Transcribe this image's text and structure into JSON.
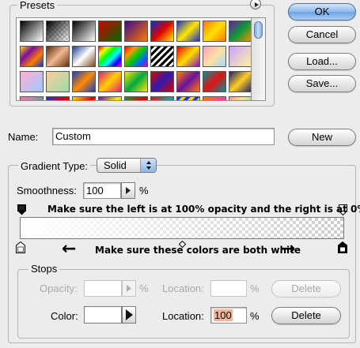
{
  "presets": {
    "label": "Presets",
    "menu_icon": "triangle-right-icon",
    "swatches": [
      {
        "name": "foreground-to-background",
        "css": "linear-gradient(135deg,#000 0%,#fff 100%)"
      },
      {
        "name": "foreground-to-transparent",
        "css": "linear-gradient(135deg,#000 0%,rgba(0,0,0,0) 100%)"
      },
      {
        "name": "black-white",
        "css": "linear-gradient(135deg,#000,#fff)"
      },
      {
        "name": "red-green",
        "css": "linear-gradient(135deg,#d40000,#006b00)"
      },
      {
        "name": "violet-orange",
        "css": "linear-gradient(135deg,#3a0a8c,#ff7a00)"
      },
      {
        "name": "blue-red-yellow",
        "css": "linear-gradient(135deg,#0033cc,#e00000 50%,#ffee00)"
      },
      {
        "name": "blue-yellow-blue",
        "css": "linear-gradient(135deg,#1a2fd0,#ffe600 50%,#1a2fd0)"
      },
      {
        "name": "orange-yellow-orange",
        "css": "linear-gradient(135deg,#ff7a00,#ffe000 50%,#ff7a00)"
      },
      {
        "name": "violet-green-orange",
        "css": "linear-gradient(135deg,#6b1aa0,#0c9a3a 50%,#ff8c00)"
      },
      {
        "name": "yellow-violet-orange-blue",
        "css": "linear-gradient(135deg,#ffd400,#7a0fa0 33%,#ff7a00 66%,#0a3cd0)"
      },
      {
        "name": "copper",
        "css": "linear-gradient(135deg,#5a2a10,#f0b890 50%,#6a3010)"
      },
      {
        "name": "chrome",
        "css": "linear-gradient(135deg,#1d3c8a,#ffffff 50%,#7a4a20)"
      },
      {
        "name": "spectrum",
        "css": "linear-gradient(135deg,#ff0000,#ffff00 20%,#00ff00 40%,#00ffff 60%,#0000ff 80%,#ff00ff)"
      },
      {
        "name": "transparent-rainbow",
        "css": "linear-gradient(135deg,#ff0000,#ff9900 25%,#00cc00 50%,#0066ff 75%,#cc00cc)"
      },
      {
        "name": "transparent-stripes",
        "css": "repeating-linear-gradient(135deg,#000 0 3px,#fff 3px 6px)"
      },
      {
        "name": "red-yellow-violet",
        "css": "linear-gradient(135deg,#e00000,#ffe000 50%,#8a10c0)"
      },
      {
        "name": "pastel",
        "css": "linear-gradient(135deg,#ff9ec0,#ffe0a0 50%,#a0d8ff)"
      },
      {
        "name": "lilac-yellow",
        "css": "linear-gradient(135deg,#c9a3ff,#fff3a0)"
      },
      {
        "name": "pink-blue",
        "css": "linear-gradient(135deg,#ffb0d0,#a0c8ff)"
      },
      {
        "name": "peach-green",
        "css": "linear-gradient(135deg,#ffcc99,#99ddaa)"
      },
      {
        "name": "blue-orange-1",
        "css": "linear-gradient(135deg,#1a3fc0,#ff8a00 50%,#1a3fc0)"
      },
      {
        "name": "magenta-yellow",
        "css": "linear-gradient(135deg,#e0207a,#ffcf00 50%,#e0207a)"
      },
      {
        "name": "yellow-green",
        "css": "linear-gradient(135deg,#ffe600,#00aa40 50%,#ffe600)"
      },
      {
        "name": "red-blue",
        "css": "linear-gradient(135deg,#e00000,#2c1ab0 50%,#e00000)"
      },
      {
        "name": "orange-violet",
        "css": "linear-gradient(135deg,#ff7a00,#6a12a0 50%,#ff7a00)"
      },
      {
        "name": "teal-red",
        "css": "linear-gradient(135deg,#00909a,#e41010 50%,#00909a)"
      },
      {
        "name": "navy-gold",
        "css": "linear-gradient(135deg,#1a2470,#ffcc20 50%,#1a2470)"
      },
      {
        "name": "pink-teal",
        "css": "linear-gradient(135deg,#ff70b0,#20b0a0)"
      },
      {
        "name": "blue-red-3",
        "css": "linear-gradient(135deg,#1a30c0,#e40000 50%,#1a30c0)"
      },
      {
        "name": "yellow-red-3",
        "css": "linear-gradient(135deg,#ffe000,#e00000 50%,#ffe000)"
      },
      {
        "name": "violet-yellow",
        "css": "linear-gradient(135deg,#6a10b0,#ffee00 50%,#6a10b0)"
      },
      {
        "name": "green-red",
        "css": "linear-gradient(135deg,#10a030,#e00000 50%,#10a030)"
      },
      {
        "name": "red-teal",
        "css": "linear-gradient(135deg,#e41010,#20a0a0 50%,#e41010)"
      },
      {
        "name": "blue-yellow-stripes",
        "css": "repeating-linear-gradient(135deg,#1a3ad0 0 4px,#ffd800 4px 8px)"
      },
      {
        "name": "orange-pink",
        "css": "linear-gradient(135deg,#ff7a00,#ff40a0 50%,#ff7a00)"
      },
      {
        "name": "pastel-rainbow",
        "css": "linear-gradient(135deg,#ff9090,#ffe090 33%,#90e0a0 66%,#90b0ff)"
      }
    ]
  },
  "buttons": {
    "ok": "OK",
    "cancel": "Cancel",
    "load": "Load...",
    "save": "Save...",
    "new": "New"
  },
  "name_row": {
    "label": "Name:",
    "value": "Custom"
  },
  "gradient_type": {
    "group_label": "Gradient Type:",
    "value": "Solid",
    "smoothness_label": "Smoothness:",
    "smoothness_value": "100",
    "smoothness_unit": "%"
  },
  "annotations": {
    "top_note": "Make sure the left is at 100% opacity and the right is at 0%",
    "bottom_note": "Make sure these colors are both white",
    "left_arrow": "←",
    "right_arrow": "→"
  },
  "stops": {
    "label": "Stops",
    "opacity_label": "Opacity:",
    "opacity_value": "",
    "opacity_unit": "%",
    "opacity_location_label": "Location:",
    "opacity_location_value": "",
    "opacity_location_unit": "%",
    "opacity_delete": "Delete",
    "color_label": "Color:",
    "color_location_label": "Location:",
    "color_location_value": "100",
    "color_location_unit": "%",
    "color_delete": "Delete",
    "color_swatch": "#ffffff",
    "location_highlight": "#f2b49a"
  },
  "colors": {
    "default_button": "#6da3e3"
  }
}
